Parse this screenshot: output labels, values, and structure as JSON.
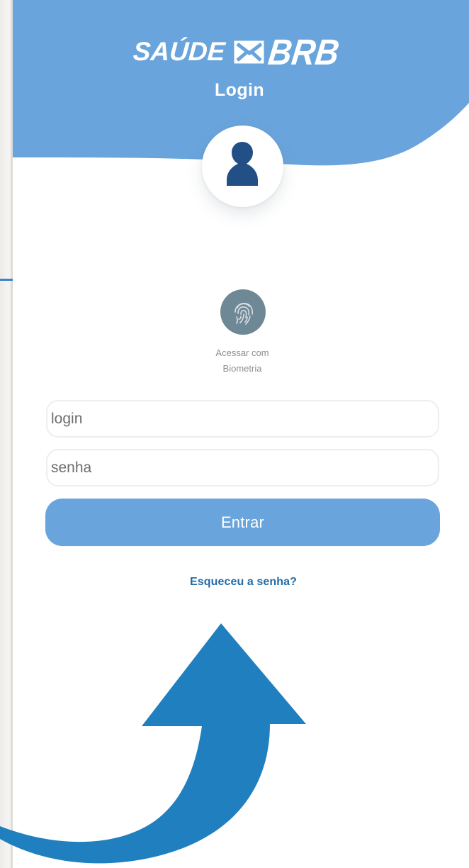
{
  "brand": {
    "saude": "SAÚDE",
    "logo_icon": "brb-envelope-logo",
    "brb": "BRB"
  },
  "screen": {
    "title": "Login"
  },
  "avatar": {
    "icon": "user-silhouette-icon"
  },
  "biometric": {
    "icon": "fingerprint-icon",
    "line1": "Acessar com",
    "line2": "Biometria"
  },
  "form": {
    "login_placeholder": "login",
    "login_value": "",
    "password_placeholder": "senha",
    "password_value": "",
    "submit_label": "Entrar",
    "forgot_password": "Esqueceu a senha?"
  },
  "annotation": {
    "icon": "curved-up-arrow"
  },
  "colors": {
    "header_blue": "#69a4dc",
    "primary_button": "#69a4dc",
    "avatar_navy": "#214f86",
    "biometric_gray": "#6f8896",
    "link_blue": "#246ca8",
    "annotation_arrow": "#207fbe"
  }
}
